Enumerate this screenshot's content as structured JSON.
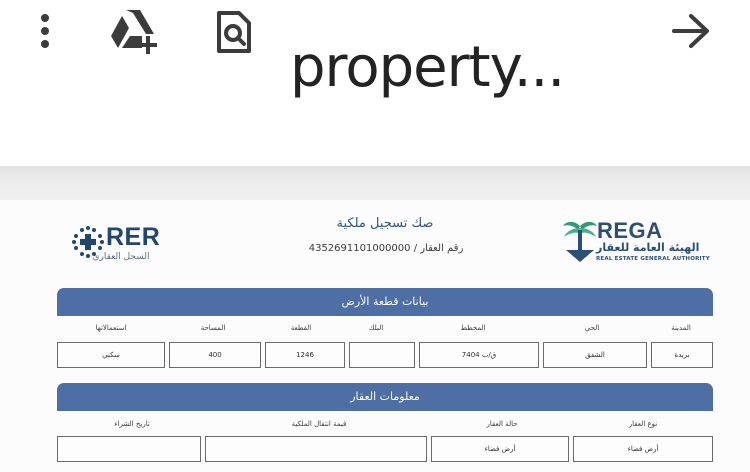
{
  "toolbar": {
    "title": "property...",
    "icons": [
      "more-vert-icon",
      "add-to-drive-icon",
      "find-in-page-icon",
      "forward-arrow-icon"
    ]
  },
  "document": {
    "rer": {
      "name": "RER",
      "subtitle": "السجل العقاري"
    },
    "deed_title": "صك تسجيل ملكية",
    "property_number": "رقم العقار / 4352691101000000",
    "rega": {
      "name": "REGA",
      "arabic": "الهيئة العامة للعقار",
      "english": "REAL ESTATE GENERAL AUTHORITY"
    },
    "land_section": {
      "title": "بيانات قطعة الأرض",
      "columns": [
        "المدينة",
        "الحي",
        "المخطط",
        "البلك",
        "القطعة",
        "المساحة",
        "استعمالاتها"
      ],
      "values": [
        "بريدة",
        "الشفق",
        "ق/ب 7404",
        "",
        "1246",
        "400",
        "سكني"
      ]
    },
    "property_section": {
      "title": "معلومات العقار",
      "columns": [
        "نوع العقار",
        "حالة العقار",
        "قيمة انتقال الملكية",
        "تاريخ الشراء"
      ],
      "values": [
        "أرض فضاء",
        "أرض فضاء",
        "",
        ""
      ]
    }
  }
}
